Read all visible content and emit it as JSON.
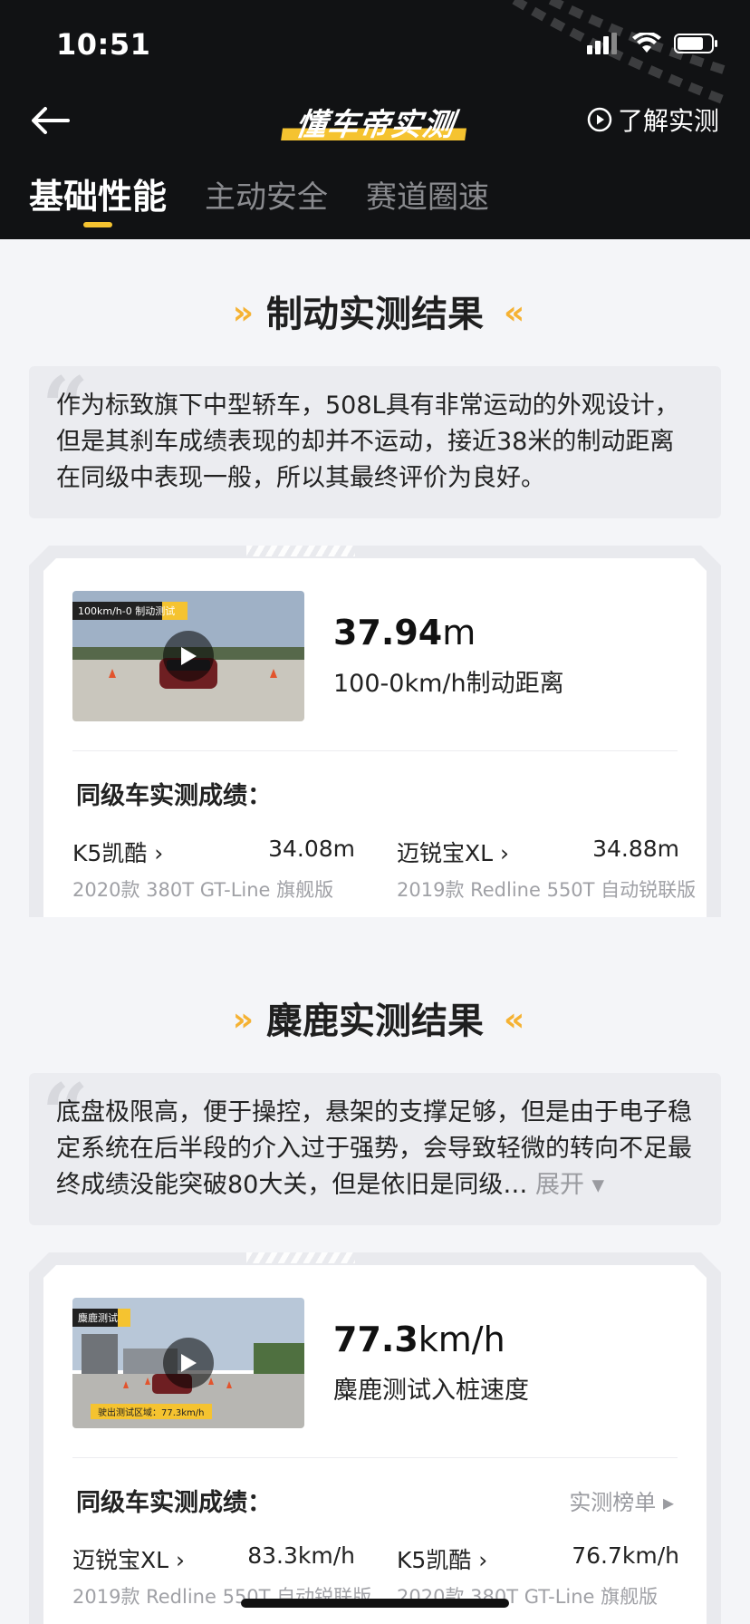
{
  "status_bar": {
    "time": "10:51"
  },
  "header": {
    "brand": "懂车帝实测",
    "learn_label": "了解实测",
    "tabs": [
      {
        "label": "基础性能",
        "active": true
      },
      {
        "label": "主动安全",
        "active": false
      },
      {
        "label": "赛道圈速",
        "active": false
      }
    ]
  },
  "colors": {
    "accent": "#f5c330",
    "header_bg": "#111214",
    "page_bg": "#f4f5f8"
  },
  "braking": {
    "title": "制动实测结果",
    "description": "作为标致旗下中型轿车，508L具有非常运动的外观设计，但是其刹车成绩表现的却并不运动，接近38米的制动距离在同级中表现一般，所以其最终评价为良好。",
    "video_tag": "100km/h-0 制动测试",
    "metric_value": "37.94",
    "metric_unit": "m",
    "metric_label": "100-0km/h制动距离",
    "peer_title": "同级车实测成绩：",
    "peers": [
      {
        "name": "K5凯酷 ›",
        "value": "34.08m",
        "sub": "2020款 380T GT-Line 旗舰版"
      },
      {
        "name": "迈锐宝XL ›",
        "value": "34.88m",
        "sub": "2019款 Redline 550T 自动锐联版"
      }
    ]
  },
  "moose": {
    "title": "麋鹿实测结果",
    "description": "底盘极限高，便于操控，悬架的支撑足够，但是由于电子稳定系统在后半段的介入过于强势，会导致轻微的转向不足最终成绩没能突破80大关，但是依旧是同级…",
    "expand_label": "展开 ▾",
    "video_tag": "麋鹿测试",
    "video_badge": "驶出测试区域：77.3km/h",
    "metric_value": "77.3",
    "metric_unit": "km/h",
    "metric_label": "麋鹿测试入桩速度",
    "peer_title": "同级车实测成绩：",
    "rank_link": "实测榜单 ▸",
    "peers": [
      {
        "name": "迈锐宝XL ›",
        "value": "83.3km/h",
        "sub": "2019款 Redline 550T 自动锐联版"
      },
      {
        "name": "K5凯酷 ›",
        "value": "76.7km/h",
        "sub": "2020款 380T GT-Line 旗舰版"
      }
    ]
  }
}
